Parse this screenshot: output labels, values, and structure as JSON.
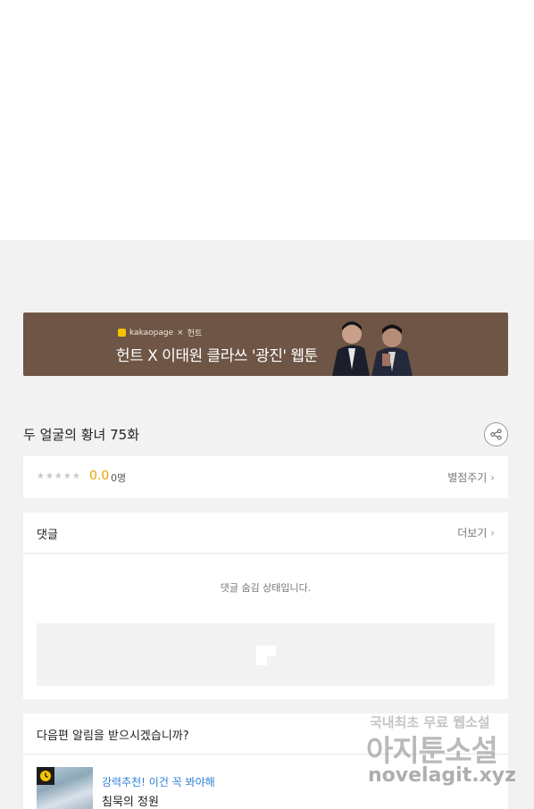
{
  "banner": {
    "brand_left": "kakaopage",
    "brand_sep": "×",
    "brand_right": "헌트",
    "headline": "헌트 X 이태원 클라쓰 '광진' 웹툰"
  },
  "episode": {
    "title": "두 얼굴의 황녀 75화"
  },
  "rating": {
    "stars": "★★★★★",
    "score": "0.0",
    "count": "0명",
    "rate_label": "별점주기"
  },
  "comments": {
    "title": "댓글",
    "more_label": "더보기",
    "hidden_message": "댓글 숨김 상태입니다."
  },
  "notify": {
    "title": "다음편 알림을 받으시겠습니까?",
    "recommend_tag": "강력추천! 이건 꼭 봐야해",
    "recommend_title": "침묵의 정원"
  },
  "watermark": {
    "line1": "국내최초 무료 웹소설",
    "line2": "아지툰소설",
    "line3": "novelagit.xyz"
  },
  "colors": {
    "banner_bg": "#6e5545",
    "score": "#e8a100",
    "recommend_tag": "#2f7fd6"
  }
}
